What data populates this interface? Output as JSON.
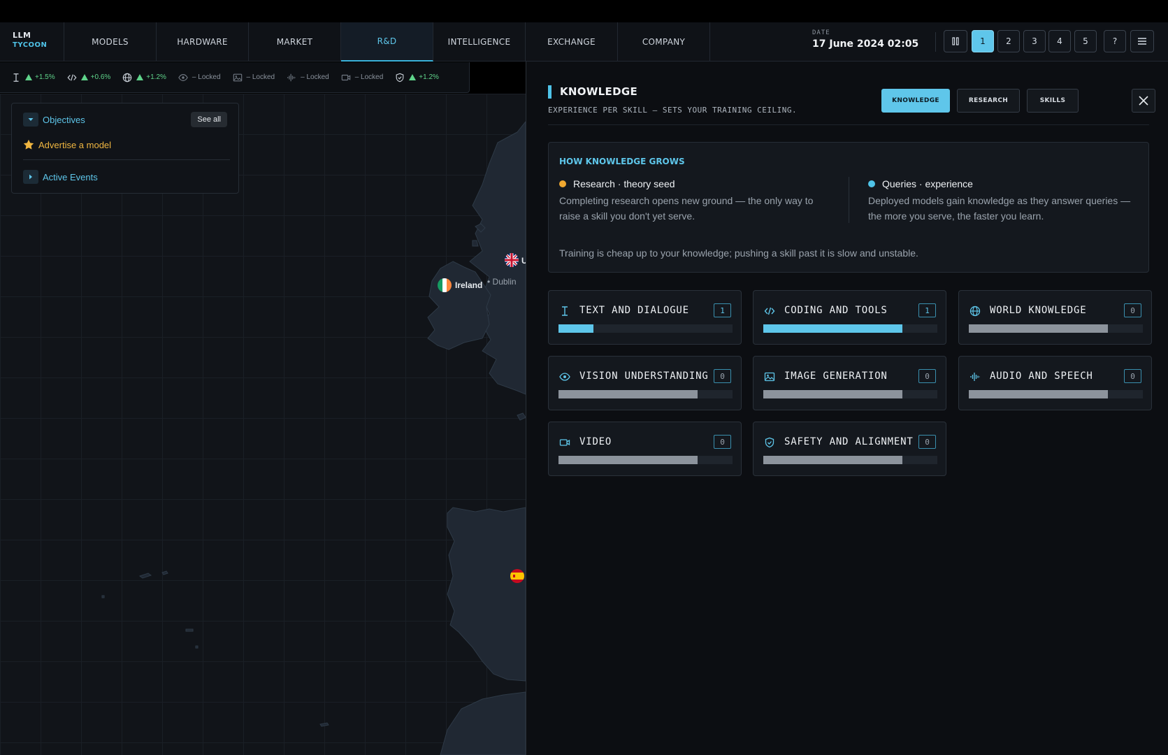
{
  "app": {
    "logo_line1": "LLM",
    "logo_line2": "TYCOON"
  },
  "nav": {
    "tabs": [
      {
        "label": "MODELS",
        "active": false
      },
      {
        "label": "HARDWARE",
        "active": false
      },
      {
        "label": "MARKET",
        "active": false
      },
      {
        "label": "R&D",
        "active": true
      },
      {
        "label": "INTELLIGENCE",
        "active": false
      },
      {
        "label": "EXCHANGE",
        "active": false
      },
      {
        "label": "COMPANY",
        "active": false
      }
    ],
    "date_label": "DATE",
    "date_value": "17 June 2024  02:05",
    "pause_icon": "pause-icon",
    "speeds": [
      "1",
      "2",
      "3",
      "4",
      "5"
    ],
    "selected_speed": "1",
    "help_label": "?",
    "menu_icon": "hamburger-icon"
  },
  "stats": [
    {
      "icon": "text-cursor-icon",
      "value": "+1.5%",
      "status": "up"
    },
    {
      "icon": "code-icon",
      "value": "+0.6%",
      "status": "up"
    },
    {
      "icon": "globe-icon",
      "value": "+1.2%",
      "status": "up"
    },
    {
      "icon": "eye-icon",
      "value": "– Locked",
      "status": "locked"
    },
    {
      "icon": "image-icon",
      "value": "– Locked",
      "status": "locked"
    },
    {
      "icon": "audio-wave-icon",
      "value": "– Locked",
      "status": "locked"
    },
    {
      "icon": "video-icon",
      "value": "– Locked",
      "status": "locked"
    },
    {
      "icon": "shield-icon",
      "value": "+1.2%",
      "status": "up"
    }
  ],
  "objectives": {
    "title": "Objectives",
    "see_all": "See all",
    "item": "Advertise a model",
    "events": "Active Events"
  },
  "map": {
    "ireland_label": "Ireland",
    "dublin_label": "Dublin",
    "uk_label": "U"
  },
  "panel": {
    "title": "KNOWLEDGE",
    "subtitle": "EXPERIENCE PER SKILL — SETS YOUR TRAINING CEILING.",
    "tabs": [
      {
        "label": "KNOWLEDGE",
        "selected": true
      },
      {
        "label": "RESEARCH",
        "selected": false
      },
      {
        "label": "SKILLS",
        "selected": false
      }
    ],
    "info": {
      "title": "HOW KNOWLEDGE GROWS",
      "research_head": "Research · theory seed",
      "research_body": "Completing research opens new ground — the only way to raise a skill you don't yet serve.",
      "queries_head": "Queries · experience",
      "queries_body": "Deployed models gain knowledge as they answer queries — the more you serve, the faster you learn.",
      "footer": "Training is cheap up to your knowledge; pushing a skill past it is slow and unstable.",
      "research_color": "#f0a830",
      "queries_color": "#4fc3e8"
    },
    "skills": [
      {
        "label": "TEXT AND DIALOGUE",
        "icon": "text-cursor-icon",
        "level": "1",
        "progress": 0.2,
        "color": "#5ec6ea"
      },
      {
        "label": "CODING AND TOOLS",
        "icon": "code-icon",
        "level": "1",
        "progress": 0.8,
        "color": "#5ec6ea"
      },
      {
        "label": "WORLD KNOWLEDGE",
        "icon": "globe-icon",
        "level": "0",
        "progress": 0.8,
        "color": "#8c939c"
      },
      {
        "label": "VISION UNDERSTANDING",
        "icon": "eye-icon",
        "level": "0",
        "progress": 0.8,
        "color": "#8c939c"
      },
      {
        "label": "IMAGE GENERATION",
        "icon": "image-icon",
        "level": "0",
        "progress": 0.8,
        "color": "#8c939c"
      },
      {
        "label": "AUDIO AND SPEECH",
        "icon": "audio-wave-icon",
        "level": "0",
        "progress": 0.8,
        "color": "#8c939c"
      },
      {
        "label": "VIDEO",
        "icon": "video-icon",
        "level": "0",
        "progress": 0.8,
        "color": "#8c939c"
      },
      {
        "label": "SAFETY AND ALIGNMENT",
        "icon": "shield-icon",
        "level": "0",
        "progress": 0.8,
        "color": "#8c939c"
      }
    ]
  }
}
